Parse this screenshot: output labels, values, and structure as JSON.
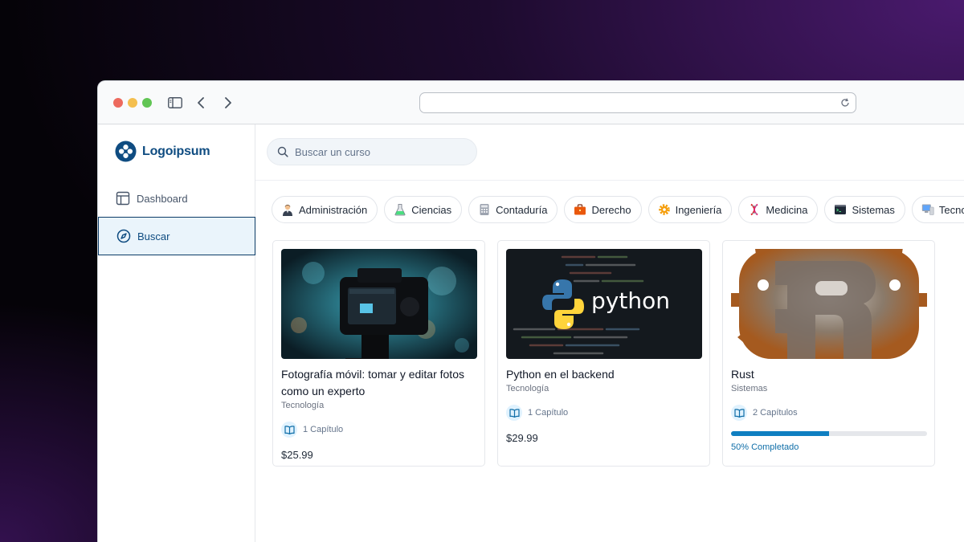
{
  "app": {
    "brand": "Logoipsum",
    "brand_color": "#0f4c81"
  },
  "sidebar": {
    "items": [
      {
        "label": "Dashboard",
        "icon": "layout-icon"
      },
      {
        "label": "Buscar",
        "icon": "compass-icon"
      }
    ]
  },
  "search": {
    "placeholder": "Buscar un curso",
    "value": ""
  },
  "categories": [
    {
      "label": "Administración",
      "icon": "person-icon"
    },
    {
      "label": "Ciencias",
      "icon": "flask-icon"
    },
    {
      "label": "Contaduría",
      "icon": "calculator-icon"
    },
    {
      "label": "Derecho",
      "icon": "briefcase-icon"
    },
    {
      "label": "Ingeniería",
      "icon": "gear-icon"
    },
    {
      "label": "Medicina",
      "icon": "dna-icon"
    },
    {
      "label": "Sistemas",
      "icon": "terminal-icon"
    },
    {
      "label": "Tecnología",
      "icon": "computer-icon"
    }
  ],
  "courses": [
    {
      "title": "Fotografía móvil: tomar y editar fotos como un experto",
      "category": "Tecnología",
      "chapters": "1 Capítulo",
      "price": "$25.99"
    },
    {
      "title": "Python en el backend",
      "category": "Tecnología",
      "chapters": "1 Capítulo",
      "price": "$29.99",
      "logo_text": "python"
    },
    {
      "title": "Rust",
      "category": "Sistemas",
      "chapters": "2 Capítulos",
      "progress": 0.5,
      "progress_label": "50% Completado"
    }
  ]
}
